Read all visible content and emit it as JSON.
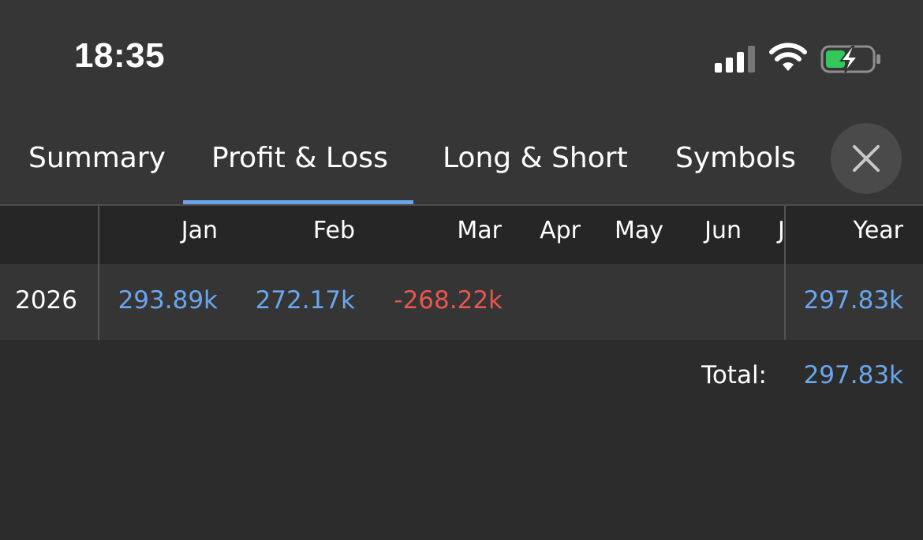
{
  "status_bar": {
    "time": "18:35",
    "icons": [
      "signal-bars-icon",
      "wifi-icon",
      "battery-charging-icon"
    ],
    "battery_color": "#34c759"
  },
  "tabs": [
    {
      "label": "Summary",
      "active": false
    },
    {
      "label": "Profit & Loss",
      "active": true
    },
    {
      "label": "Long & Short",
      "active": false
    },
    {
      "label": "Symbols",
      "active": false
    }
  ],
  "close_icon": "close-icon",
  "colors": {
    "accent": "#6aa6ec",
    "positive": "#6aa6ec",
    "negative": "#e8554e",
    "background": "#2c2c2c"
  },
  "table": {
    "month_headers": [
      "Jan",
      "Feb",
      "Mar",
      "Apr",
      "May",
      "Jun",
      "J"
    ],
    "year_header": "Year",
    "rows": [
      {
        "label": "2026",
        "jan": "293.89k",
        "feb": "272.17k",
        "mar": "-268.22k",
        "year": "297.83k"
      }
    ]
  },
  "total": {
    "label": "Total:",
    "value": "297.83k"
  }
}
